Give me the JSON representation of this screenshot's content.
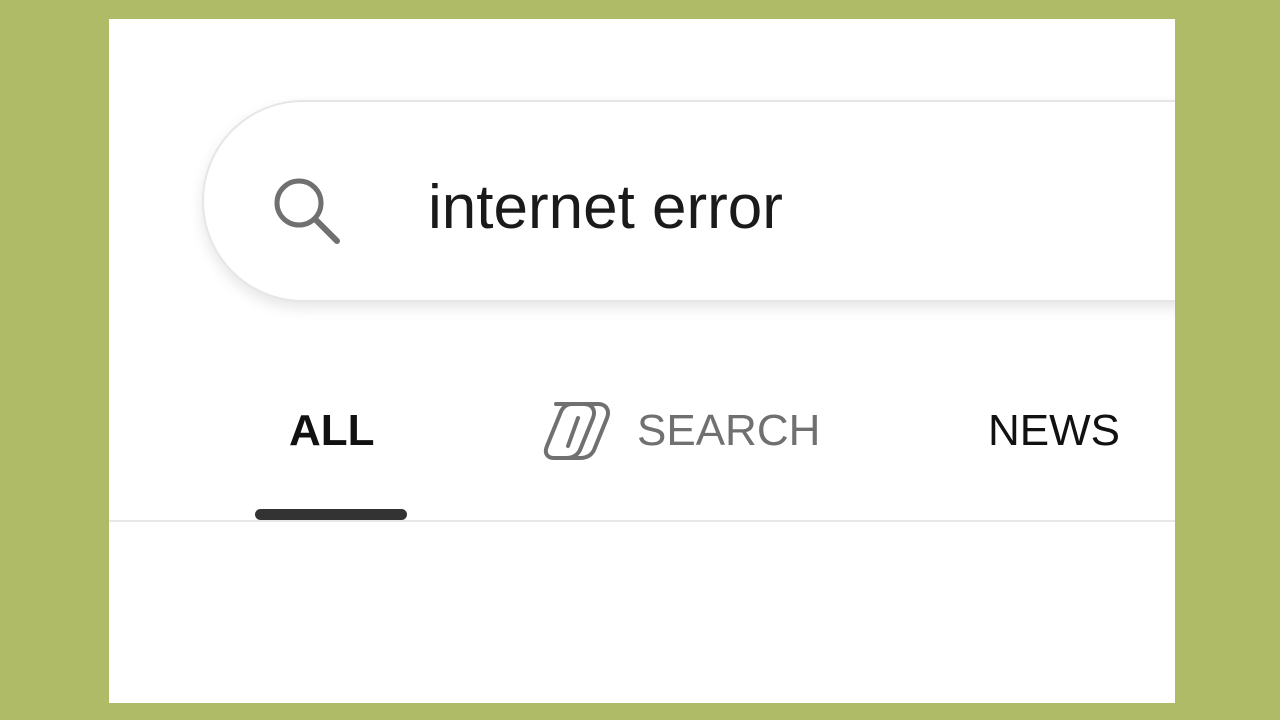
{
  "search": {
    "query": "internet error",
    "icon": "search-icon"
  },
  "tabs": [
    {
      "label": "ALL",
      "active": true
    },
    {
      "label": "SEARCH",
      "active": false,
      "icon": "copilot-icon"
    },
    {
      "label": "NEWS",
      "active": false
    }
  ],
  "colors": {
    "background": "#b0bb67",
    "panel": "#ffffff",
    "active_tab_text": "#111111",
    "inactive_tab_text": "#707070",
    "active_indicator": "#333333"
  }
}
